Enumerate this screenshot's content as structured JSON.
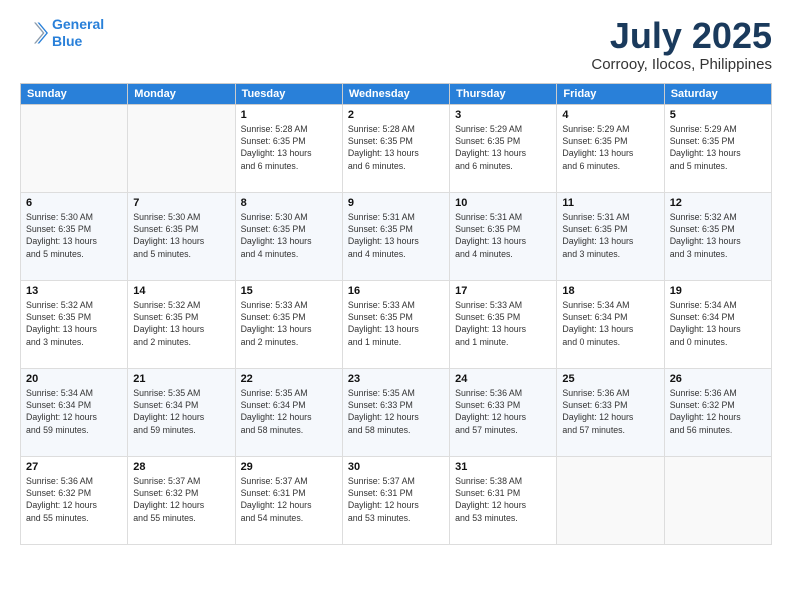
{
  "logo": {
    "line1": "General",
    "line2": "Blue"
  },
  "title": "July 2025",
  "subtitle": "Corrooy, Ilocos, Philippines",
  "days_of_week": [
    "Sunday",
    "Monday",
    "Tuesday",
    "Wednesday",
    "Thursday",
    "Friday",
    "Saturday"
  ],
  "weeks": [
    [
      {
        "day": "",
        "detail": ""
      },
      {
        "day": "",
        "detail": ""
      },
      {
        "day": "1",
        "detail": "Sunrise: 5:28 AM\nSunset: 6:35 PM\nDaylight: 13 hours\nand 6 minutes."
      },
      {
        "day": "2",
        "detail": "Sunrise: 5:28 AM\nSunset: 6:35 PM\nDaylight: 13 hours\nand 6 minutes."
      },
      {
        "day": "3",
        "detail": "Sunrise: 5:29 AM\nSunset: 6:35 PM\nDaylight: 13 hours\nand 6 minutes."
      },
      {
        "day": "4",
        "detail": "Sunrise: 5:29 AM\nSunset: 6:35 PM\nDaylight: 13 hours\nand 6 minutes."
      },
      {
        "day": "5",
        "detail": "Sunrise: 5:29 AM\nSunset: 6:35 PM\nDaylight: 13 hours\nand 5 minutes."
      }
    ],
    [
      {
        "day": "6",
        "detail": "Sunrise: 5:30 AM\nSunset: 6:35 PM\nDaylight: 13 hours\nand 5 minutes."
      },
      {
        "day": "7",
        "detail": "Sunrise: 5:30 AM\nSunset: 6:35 PM\nDaylight: 13 hours\nand 5 minutes."
      },
      {
        "day": "8",
        "detail": "Sunrise: 5:30 AM\nSunset: 6:35 PM\nDaylight: 13 hours\nand 4 minutes."
      },
      {
        "day": "9",
        "detail": "Sunrise: 5:31 AM\nSunset: 6:35 PM\nDaylight: 13 hours\nand 4 minutes."
      },
      {
        "day": "10",
        "detail": "Sunrise: 5:31 AM\nSunset: 6:35 PM\nDaylight: 13 hours\nand 4 minutes."
      },
      {
        "day": "11",
        "detail": "Sunrise: 5:31 AM\nSunset: 6:35 PM\nDaylight: 13 hours\nand 3 minutes."
      },
      {
        "day": "12",
        "detail": "Sunrise: 5:32 AM\nSunset: 6:35 PM\nDaylight: 13 hours\nand 3 minutes."
      }
    ],
    [
      {
        "day": "13",
        "detail": "Sunrise: 5:32 AM\nSunset: 6:35 PM\nDaylight: 13 hours\nand 3 minutes."
      },
      {
        "day": "14",
        "detail": "Sunrise: 5:32 AM\nSunset: 6:35 PM\nDaylight: 13 hours\nand 2 minutes."
      },
      {
        "day": "15",
        "detail": "Sunrise: 5:33 AM\nSunset: 6:35 PM\nDaylight: 13 hours\nand 2 minutes."
      },
      {
        "day": "16",
        "detail": "Sunrise: 5:33 AM\nSunset: 6:35 PM\nDaylight: 13 hours\nand 1 minute."
      },
      {
        "day": "17",
        "detail": "Sunrise: 5:33 AM\nSunset: 6:35 PM\nDaylight: 13 hours\nand 1 minute."
      },
      {
        "day": "18",
        "detail": "Sunrise: 5:34 AM\nSunset: 6:34 PM\nDaylight: 13 hours\nand 0 minutes."
      },
      {
        "day": "19",
        "detail": "Sunrise: 5:34 AM\nSunset: 6:34 PM\nDaylight: 13 hours\nand 0 minutes."
      }
    ],
    [
      {
        "day": "20",
        "detail": "Sunrise: 5:34 AM\nSunset: 6:34 PM\nDaylight: 12 hours\nand 59 minutes."
      },
      {
        "day": "21",
        "detail": "Sunrise: 5:35 AM\nSunset: 6:34 PM\nDaylight: 12 hours\nand 59 minutes."
      },
      {
        "day": "22",
        "detail": "Sunrise: 5:35 AM\nSunset: 6:34 PM\nDaylight: 12 hours\nand 58 minutes."
      },
      {
        "day": "23",
        "detail": "Sunrise: 5:35 AM\nSunset: 6:33 PM\nDaylight: 12 hours\nand 58 minutes."
      },
      {
        "day": "24",
        "detail": "Sunrise: 5:36 AM\nSunset: 6:33 PM\nDaylight: 12 hours\nand 57 minutes."
      },
      {
        "day": "25",
        "detail": "Sunrise: 5:36 AM\nSunset: 6:33 PM\nDaylight: 12 hours\nand 57 minutes."
      },
      {
        "day": "26",
        "detail": "Sunrise: 5:36 AM\nSunset: 6:32 PM\nDaylight: 12 hours\nand 56 minutes."
      }
    ],
    [
      {
        "day": "27",
        "detail": "Sunrise: 5:36 AM\nSunset: 6:32 PM\nDaylight: 12 hours\nand 55 minutes."
      },
      {
        "day": "28",
        "detail": "Sunrise: 5:37 AM\nSunset: 6:32 PM\nDaylight: 12 hours\nand 55 minutes."
      },
      {
        "day": "29",
        "detail": "Sunrise: 5:37 AM\nSunset: 6:31 PM\nDaylight: 12 hours\nand 54 minutes."
      },
      {
        "day": "30",
        "detail": "Sunrise: 5:37 AM\nSunset: 6:31 PM\nDaylight: 12 hours\nand 53 minutes."
      },
      {
        "day": "31",
        "detail": "Sunrise: 5:38 AM\nSunset: 6:31 PM\nDaylight: 12 hours\nand 53 minutes."
      },
      {
        "day": "",
        "detail": ""
      },
      {
        "day": "",
        "detail": ""
      }
    ]
  ]
}
